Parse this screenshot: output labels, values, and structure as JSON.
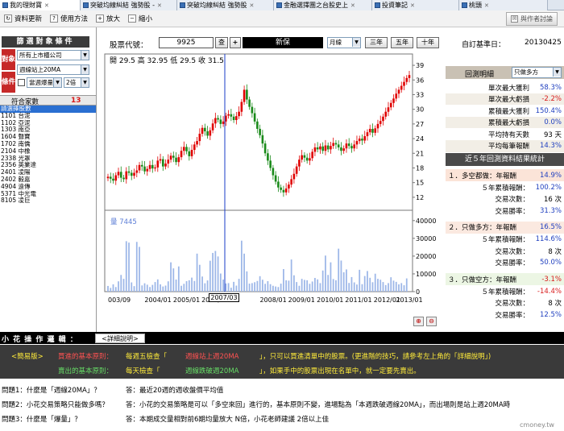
{
  "tabs": [
    {
      "label": "我的理財寶"
    },
    {
      "label": "突破均線糾結 強勢股 -"
    },
    {
      "label": "突破均線糾結 強勢股"
    },
    {
      "label": "金融選擇團之台股史上"
    },
    {
      "label": "投資筆記"
    },
    {
      "label": "桃頭"
    }
  ],
  "toolbar": {
    "update": "資料更新",
    "howto": "使用方法",
    "zoom_in": "放大",
    "zoom_out": "縮小",
    "discuss": "與作者討論"
  },
  "conditions": {
    "title": "篩選對象條件",
    "obj_label": "對象",
    "cond_label": "條件",
    "market": "所有上市櫃公司",
    "ma": "週線站上20MA",
    "vol": "當週爆量",
    "mult": "2倍"
  },
  "list": {
    "header": "符合家數",
    "count": "13",
    "items": [
      "請選擇股數",
      "1101 台泥",
      "1102 亞泥",
      "1303 南亞",
      "1604 聲寶",
      "1702 南僑",
      "2104 中橡",
      "2338 光罩",
      "2356 英業達",
      "2401 凌陽",
      "2402 毅嘉",
      "4904 遠傳",
      "5371 中光電",
      "8105 凌巨"
    ]
  },
  "query": {
    "code_label": "股票代號：",
    "code_value": "9925",
    "lookup_btn": "查",
    "add_btn": "+",
    "stock_name": "新保",
    "period": "月線",
    "y3": "三年",
    "y5": "五年",
    "y10": "十年",
    "base_label": "自訂基準日：",
    "base_date": "20130425"
  },
  "chart_data": [
    {
      "type": "candlestick",
      "ohlc_label": "開 29.5  高 32.95  低 29.5  收 31.5",
      "x_ticks": [
        "003/09",
        "2004/01",
        "2005/01",
        "2006/01",
        "2007/03",
        "2008/01",
        "2009/01",
        "2010/01",
        "2011/01",
        "2012/01",
        "2013/01"
      ],
      "cursor_label": "2007/03",
      "y_ticks": [
        12,
        15,
        18,
        21,
        24,
        27,
        30,
        33,
        36,
        39
      ],
      "ylim": [
        10,
        40
      ],
      "close": [
        16.2,
        15.8,
        15.4,
        16.5,
        17.2,
        16.0,
        15.7,
        17.3,
        17.0,
        16.4,
        17.0,
        17.5,
        18.6,
        18.3,
        17.3,
        17.8,
        18.6,
        17.9,
        18.1,
        19.5,
        19.8,
        18.3,
        18.9,
        19.7,
        20.5,
        20.1,
        19.2,
        20.2,
        21.5,
        22.3,
        21.4,
        20.4,
        21.7,
        22.8,
        23.5,
        25.0,
        26.2,
        25.5,
        24.6,
        25.7,
        27.1,
        28.2,
        27.9,
        27.0,
        27.5,
        28.7,
        29.0,
        28.5,
        27.8,
        28.6,
        29.5,
        31.5,
        34.0,
        32.0,
        30.5,
        29.2,
        27.5,
        26.0,
        24.7,
        23.0,
        21.0,
        19.5,
        18.0,
        16.5,
        15.2,
        14.0,
        13.5,
        13.0,
        13.8,
        14.6,
        15.7,
        16.8,
        18.3,
        19.7,
        20.6,
        20.1,
        19.5,
        20.0,
        21.3,
        22.2,
        21.8,
        22.4,
        21.5,
        22.6,
        21.8,
        22.5,
        23.1,
        22.8,
        22.2,
        21.5,
        22.0,
        23.0,
        22.5,
        22.0,
        22.8,
        23.5,
        24.0,
        23.6,
        24.5,
        25.3,
        26.0,
        25.2,
        26.1,
        27.0,
        27.6,
        28.5,
        29.5,
        30.4,
        31.3,
        32.2,
        33.2,
        34.0,
        34.8,
        35.6,
        36.4,
        37.0
      ],
      "volume_label": "量 7445",
      "vol_ticks": [
        0,
        10000,
        20000,
        30000,
        40000
      ],
      "vol_ylim": [
        0,
        44000
      ],
      "volume": [
        3200,
        2100,
        4100,
        2600,
        5800,
        9400,
        7200,
        28400,
        27600,
        5200,
        3100,
        28000,
        25200,
        3500,
        4700,
        3900,
        2600,
        3800,
        5400,
        6900,
        4100,
        2900,
        3400,
        5800,
        16500,
        13100,
        6800,
        14200,
        3300,
        4400,
        5900,
        6400,
        7900,
        6000,
        21400,
        15100,
        8500,
        4700,
        6300,
        17400,
        21800,
        22900,
        19800,
        10200,
        6800,
        4600,
        4800,
        2200,
        5500,
        3400,
        7200,
        28700,
        21400,
        11400,
        4500,
        4800,
        5300,
        6000,
        8700,
        6700,
        4400,
        5900,
        4200,
        3300,
        2900,
        2600,
        4500,
        12700,
        6400,
        6200,
        18100,
        9200,
        5400,
        3300,
        7200,
        6600,
        6400,
        4400,
        5700,
        7700,
        6900,
        4800,
        11900,
        20300,
        9400,
        16500,
        7100,
        6400,
        24200,
        17500,
        10900,
        12500,
        4900,
        8200,
        5200,
        4000,
        12300,
        4200,
        8800,
        11600,
        7800,
        5300,
        10100,
        7200,
        6700,
        5400,
        3700,
        4800,
        8100,
        6200,
        5500,
        4100,
        4800,
        3600,
        7445
      ]
    }
  ],
  "right": {
    "section1_title": "回測明細",
    "mode": "只做多方",
    "rows1": [
      {
        "label": "單次最大獲利",
        "value": "58.3%",
        "color": "#1f3fbf"
      },
      {
        "label": "單次最大虧損",
        "value": "-2.2%",
        "color": "#d81b1b"
      },
      {
        "label": "累積最大獲利",
        "value": "150.4%",
        "color": "#1f3fbf"
      },
      {
        "label": "累積最大虧損",
        "value": "0.0%",
        "color": "#1f3fbf"
      },
      {
        "label": "平均持有天數",
        "value": "93 天",
        "color": "#000000"
      },
      {
        "label": "平均每筆報酬",
        "value": "14.3%",
        "color": "#1f3fbf"
      }
    ],
    "section2_title": "近５年回測資料結果統計",
    "groups": [
      {
        "title": "１．多空都做：年報酬",
        "value": "14.9%",
        "vcolor": "#1f3fbf",
        "bg": "#fbe4d8",
        "rows": [
          {
            "label": "５年累積報酬：",
            "value": "100.2%",
            "color": "#1f3fbf"
          },
          {
            "label": "交易次數：",
            "value": "16 次",
            "color": "#000000"
          },
          {
            "label": "交易勝率：",
            "value": "31.3%",
            "color": "#1f3fbf"
          }
        ]
      },
      {
        "title": "２．只做多方：年報酬",
        "value": "16.5%",
        "vcolor": "#1f3fbf",
        "bg": "#fbe9e0",
        "rows": [
          {
            "label": "５年累積報酬：",
            "value": "114.6%",
            "color": "#1f3fbf"
          },
          {
            "label": "交易次數：",
            "value": "8 次",
            "color": "#000000"
          },
          {
            "label": "交易勝率：",
            "value": "50.0%",
            "color": "#1f3fbf"
          }
        ]
      },
      {
        "title": "３．只做空方：年報酬",
        "value": "-3.1%",
        "vcolor": "#d81b1b",
        "bg": "#ecf6e4",
        "rows": [
          {
            "label": "５年累積報酬：",
            "value": "-14.4%",
            "color": "#d81b1b"
          },
          {
            "label": "交易次數：",
            "value": "8 次",
            "color": "#000000"
          },
          {
            "label": "交易勝率：",
            "value": "12.5%",
            "color": "#1f3fbf"
          }
        ]
      }
    ]
  },
  "ops": {
    "title": "小 花 操 作 邏 輯 ：",
    "detail_btn": "<詳細說明>",
    "simple": "<簡易版>",
    "buy_head": "買進的基本原則：",
    "buy_text1": "每週五檢查「",
    "buy_key": "週線站上週20MA",
    "buy_text2": "」，只可以買進清單中的股票。(更進階的技巧，請參考左上角的「詳細說明」)",
    "sell_head": "賣出的基本原則：",
    "sell_text1": "每天檢查「",
    "sell_key": "週線跌破週20MA",
    "sell_text2": "」，如果手中的股票出現在名單中，就一定要先賣出。"
  },
  "qa": [
    {
      "q": "問題1：什麼是「週線20MA」？",
      "a": "答：最近20週的週收盤價平均值"
    },
    {
      "q": "問題2：小花交易策略只能做多嗎？",
      "a": "答：小花的交易策略是可以「多空來回」進行的，基本原則不變，進場點為「本週跌破週線20MA」，而出場則是站上週20MA時"
    },
    {
      "q": "問題3：什麼是「爆量」？",
      "a": "答：本期成交量相對前6期均量放大 N倍，小花老師建議 2倍以上佳"
    }
  ],
  "watermark": "cmoney.tw",
  "colors": {
    "up": "#e00000",
    "down": "#1a8a1a",
    "volume": "#9db7e8",
    "dark_bar": "#3a3a3a"
  }
}
